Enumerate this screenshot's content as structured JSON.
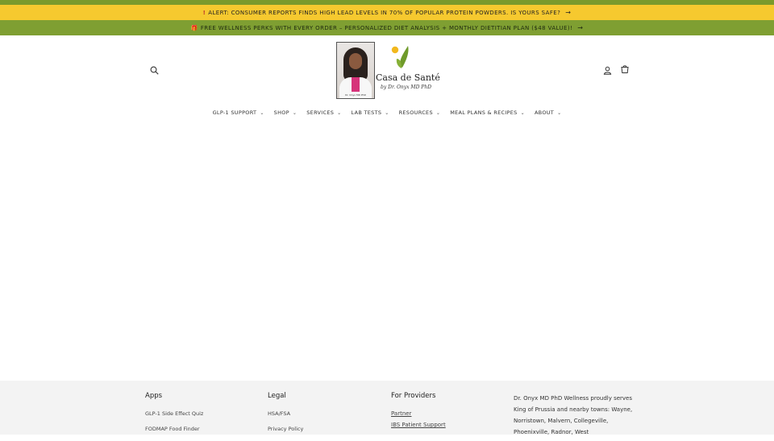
{
  "alert_bar": {
    "icon": "!",
    "text": "ALERT: CONSUMER REPORTS FINDS HIGH LEAD LEVELS IN 70% OF POPULAR PROTEIN POWDERS. IS YOURS SAFE?",
    "arrow": "→",
    "color": "#f6c92f"
  },
  "promo_bar": {
    "icon": "🎁",
    "text": "FREE WELLNESS PERKS WITH EVERY ORDER – PERSONALIZED DIET ANALYSIS + MONTHLY DIETITIAN PLAN ($48 VALUE)!",
    "arrow": "→",
    "color": "#7f9f32"
  },
  "header": {
    "search_icon": "search-icon",
    "account_icon": "account-icon",
    "cart_icon": "cart-icon",
    "logo": {
      "brand": "Casa de Santé",
      "subtitle": "by Dr. Onyx MD PhD",
      "photo_caption": "Dr. Onyx MD PhD"
    }
  },
  "nav": {
    "items": [
      {
        "label": "GLP-1 SUPPORT"
      },
      {
        "label": "SHOP"
      },
      {
        "label": "SERVICES"
      },
      {
        "label": "LAB TESTS"
      },
      {
        "label": "RESOURCES"
      },
      {
        "label": "MEAL PLANS & RECIPES"
      },
      {
        "label": "ABOUT"
      }
    ],
    "chevron": "⌄"
  },
  "footer": {
    "apps": {
      "heading": "Apps",
      "links": [
        "GLP-1 Side Effect Quiz",
        "FODMAP Food Finder"
      ]
    },
    "legal": {
      "heading": "Legal",
      "links": [
        "HSA/FSA",
        "Privacy Policy"
      ]
    },
    "providers": {
      "heading": "For Providers",
      "links": [
        "Partner",
        "IBS Patient Support"
      ]
    },
    "blurb": "Dr. Onyx MD PhD Wellness proudly serves King of Prussia and nearby towns: Wayne, Norristown, Malvern, Collegeville, Phoenixville, Radnor, West"
  }
}
